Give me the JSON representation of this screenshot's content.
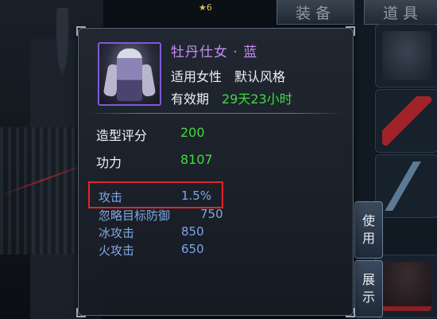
{
  "tabs": {
    "equip": "装备",
    "items": "道具"
  },
  "star_badge": "★6",
  "tooltip": {
    "title": "牡丹仕女 · 蓝",
    "suitable_label": "适用",
    "suitable_value": "女性",
    "default_style": "默认风格",
    "validity_label": "有效期",
    "validity_value": "29天23小时",
    "stats": [
      {
        "label": "造型评分",
        "value": "200"
      },
      {
        "label": "功力",
        "value": "8107"
      }
    ],
    "attributes": [
      {
        "label": "攻击",
        "value": "1.5%"
      },
      {
        "label": "忽略目标防御",
        "value": "750"
      },
      {
        "label": "冰攻击",
        "value": "850"
      },
      {
        "label": "火攻击",
        "value": "650"
      }
    ]
  },
  "buttons": {
    "use": [
      "使",
      "用"
    ],
    "show": [
      "展",
      "示"
    ]
  },
  "colors": {
    "title": "#c78cf0",
    "value_green": "#3fdc3f",
    "attribute_blue": "#7fa6e6",
    "highlight_red": "#e0262b",
    "portrait_border": "#7d5bd6"
  }
}
